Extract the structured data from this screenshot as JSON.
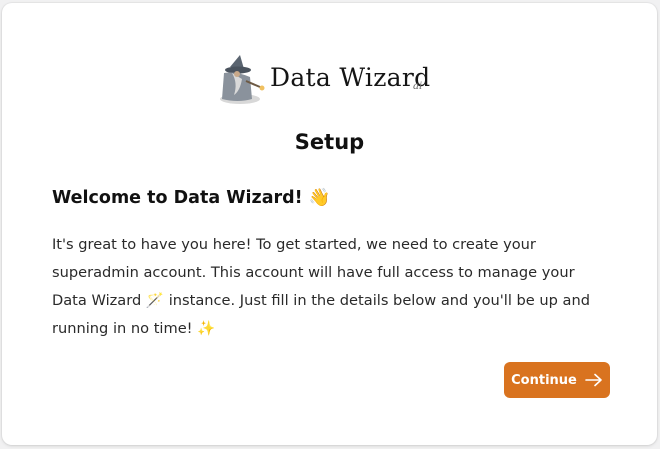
{
  "logo": {
    "name": "Data Wizard",
    "suffix": "ai"
  },
  "page_title": "Setup",
  "welcome": {
    "heading": "Welcome to Data Wizard! 👋",
    "paragraph": "It's great to have you here! To get started, we need to create your superadmin account. This account will have full access to manage your Data Wizard 🪄 instance. Just fill in the details below and you'll be up and running in no time! ✨"
  },
  "actions": {
    "continue_label": "Continue",
    "continue_icon": "arrow-right-icon"
  },
  "colors": {
    "accent": "#d9731f",
    "background": "#f1f1f2",
    "card": "#ffffff"
  }
}
